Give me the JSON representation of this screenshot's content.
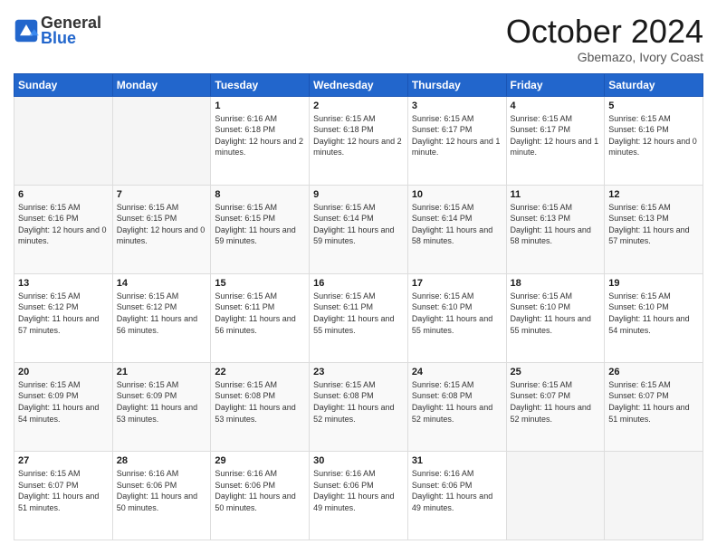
{
  "header": {
    "logo_line1": "General",
    "logo_line2": "Blue",
    "month": "October 2024",
    "location": "Gbemazo, Ivory Coast"
  },
  "weekdays": [
    "Sunday",
    "Monday",
    "Tuesday",
    "Wednesday",
    "Thursday",
    "Friday",
    "Saturday"
  ],
  "weeks": [
    [
      {
        "day": "",
        "sunrise": "",
        "sunset": "",
        "daylight": ""
      },
      {
        "day": "",
        "sunrise": "",
        "sunset": "",
        "daylight": ""
      },
      {
        "day": "1",
        "sunrise": "Sunrise: 6:16 AM",
        "sunset": "Sunset: 6:18 PM",
        "daylight": "Daylight: 12 hours and 2 minutes."
      },
      {
        "day": "2",
        "sunrise": "Sunrise: 6:15 AM",
        "sunset": "Sunset: 6:18 PM",
        "daylight": "Daylight: 12 hours and 2 minutes."
      },
      {
        "day": "3",
        "sunrise": "Sunrise: 6:15 AM",
        "sunset": "Sunset: 6:17 PM",
        "daylight": "Daylight: 12 hours and 1 minute."
      },
      {
        "day": "4",
        "sunrise": "Sunrise: 6:15 AM",
        "sunset": "Sunset: 6:17 PM",
        "daylight": "Daylight: 12 hours and 1 minute."
      },
      {
        "day": "5",
        "sunrise": "Sunrise: 6:15 AM",
        "sunset": "Sunset: 6:16 PM",
        "daylight": "Daylight: 12 hours and 0 minutes."
      }
    ],
    [
      {
        "day": "6",
        "sunrise": "Sunrise: 6:15 AM",
        "sunset": "Sunset: 6:16 PM",
        "daylight": "Daylight: 12 hours and 0 minutes."
      },
      {
        "day": "7",
        "sunrise": "Sunrise: 6:15 AM",
        "sunset": "Sunset: 6:15 PM",
        "daylight": "Daylight: 12 hours and 0 minutes."
      },
      {
        "day": "8",
        "sunrise": "Sunrise: 6:15 AM",
        "sunset": "Sunset: 6:15 PM",
        "daylight": "Daylight: 11 hours and 59 minutes."
      },
      {
        "day": "9",
        "sunrise": "Sunrise: 6:15 AM",
        "sunset": "Sunset: 6:14 PM",
        "daylight": "Daylight: 11 hours and 59 minutes."
      },
      {
        "day": "10",
        "sunrise": "Sunrise: 6:15 AM",
        "sunset": "Sunset: 6:14 PM",
        "daylight": "Daylight: 11 hours and 58 minutes."
      },
      {
        "day": "11",
        "sunrise": "Sunrise: 6:15 AM",
        "sunset": "Sunset: 6:13 PM",
        "daylight": "Daylight: 11 hours and 58 minutes."
      },
      {
        "day": "12",
        "sunrise": "Sunrise: 6:15 AM",
        "sunset": "Sunset: 6:13 PM",
        "daylight": "Daylight: 11 hours and 57 minutes."
      }
    ],
    [
      {
        "day": "13",
        "sunrise": "Sunrise: 6:15 AM",
        "sunset": "Sunset: 6:12 PM",
        "daylight": "Daylight: 11 hours and 57 minutes."
      },
      {
        "day": "14",
        "sunrise": "Sunrise: 6:15 AM",
        "sunset": "Sunset: 6:12 PM",
        "daylight": "Daylight: 11 hours and 56 minutes."
      },
      {
        "day": "15",
        "sunrise": "Sunrise: 6:15 AM",
        "sunset": "Sunset: 6:11 PM",
        "daylight": "Daylight: 11 hours and 56 minutes."
      },
      {
        "day": "16",
        "sunrise": "Sunrise: 6:15 AM",
        "sunset": "Sunset: 6:11 PM",
        "daylight": "Daylight: 11 hours and 55 minutes."
      },
      {
        "day": "17",
        "sunrise": "Sunrise: 6:15 AM",
        "sunset": "Sunset: 6:10 PM",
        "daylight": "Daylight: 11 hours and 55 minutes."
      },
      {
        "day": "18",
        "sunrise": "Sunrise: 6:15 AM",
        "sunset": "Sunset: 6:10 PM",
        "daylight": "Daylight: 11 hours and 55 minutes."
      },
      {
        "day": "19",
        "sunrise": "Sunrise: 6:15 AM",
        "sunset": "Sunset: 6:10 PM",
        "daylight": "Daylight: 11 hours and 54 minutes."
      }
    ],
    [
      {
        "day": "20",
        "sunrise": "Sunrise: 6:15 AM",
        "sunset": "Sunset: 6:09 PM",
        "daylight": "Daylight: 11 hours and 54 minutes."
      },
      {
        "day": "21",
        "sunrise": "Sunrise: 6:15 AM",
        "sunset": "Sunset: 6:09 PM",
        "daylight": "Daylight: 11 hours and 53 minutes."
      },
      {
        "day": "22",
        "sunrise": "Sunrise: 6:15 AM",
        "sunset": "Sunset: 6:08 PM",
        "daylight": "Daylight: 11 hours and 53 minutes."
      },
      {
        "day": "23",
        "sunrise": "Sunrise: 6:15 AM",
        "sunset": "Sunset: 6:08 PM",
        "daylight": "Daylight: 11 hours and 52 minutes."
      },
      {
        "day": "24",
        "sunrise": "Sunrise: 6:15 AM",
        "sunset": "Sunset: 6:08 PM",
        "daylight": "Daylight: 11 hours and 52 minutes."
      },
      {
        "day": "25",
        "sunrise": "Sunrise: 6:15 AM",
        "sunset": "Sunset: 6:07 PM",
        "daylight": "Daylight: 11 hours and 52 minutes."
      },
      {
        "day": "26",
        "sunrise": "Sunrise: 6:15 AM",
        "sunset": "Sunset: 6:07 PM",
        "daylight": "Daylight: 11 hours and 51 minutes."
      }
    ],
    [
      {
        "day": "27",
        "sunrise": "Sunrise: 6:15 AM",
        "sunset": "Sunset: 6:07 PM",
        "daylight": "Daylight: 11 hours and 51 minutes."
      },
      {
        "day": "28",
        "sunrise": "Sunrise: 6:16 AM",
        "sunset": "Sunset: 6:06 PM",
        "daylight": "Daylight: 11 hours and 50 minutes."
      },
      {
        "day": "29",
        "sunrise": "Sunrise: 6:16 AM",
        "sunset": "Sunset: 6:06 PM",
        "daylight": "Daylight: 11 hours and 50 minutes."
      },
      {
        "day": "30",
        "sunrise": "Sunrise: 6:16 AM",
        "sunset": "Sunset: 6:06 PM",
        "daylight": "Daylight: 11 hours and 49 minutes."
      },
      {
        "day": "31",
        "sunrise": "Sunrise: 6:16 AM",
        "sunset": "Sunset: 6:06 PM",
        "daylight": "Daylight: 11 hours and 49 minutes."
      },
      {
        "day": "",
        "sunrise": "",
        "sunset": "",
        "daylight": ""
      },
      {
        "day": "",
        "sunrise": "",
        "sunset": "",
        "daylight": ""
      }
    ]
  ]
}
